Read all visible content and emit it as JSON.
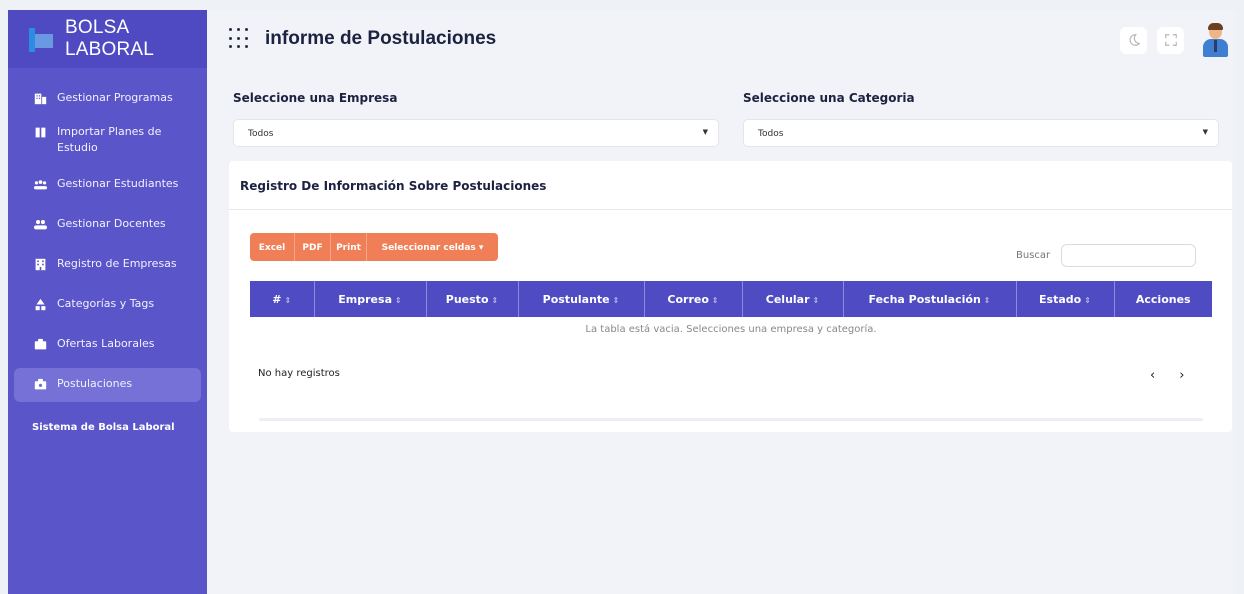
{
  "brand": {
    "title": "BOLSA LABORAL"
  },
  "sidebar": {
    "items": [
      {
        "label": "Gestionar Programas",
        "icon": "building-icon",
        "active": false
      },
      {
        "label": "Importar Planes de Estudio",
        "icon": "book-icon",
        "active": false
      },
      {
        "label": "Gestionar Estudiantes",
        "icon": "users-icon",
        "active": false
      },
      {
        "label": "Gestionar Docentes",
        "icon": "user-group-icon",
        "active": false
      },
      {
        "label": "Registro de Empresas",
        "icon": "building-icon",
        "active": false
      },
      {
        "label": "Categorías y Tags",
        "icon": "shapes-icon",
        "active": false
      },
      {
        "label": "Ofertas Laborales",
        "icon": "briefcase-icon",
        "active": false
      },
      {
        "label": "Postulaciones",
        "icon": "briefcase-user-icon",
        "active": true
      }
    ],
    "system_title": "Sistema de Bolsa Laboral"
  },
  "header": {
    "title": "informe de Postulaciones"
  },
  "filters": {
    "empresa_label": "Seleccione una Empresa",
    "empresa_value": "Todos",
    "categoria_label": "Seleccione una Categoria",
    "categoria_value": "Todos"
  },
  "card": {
    "title": "Registro De Información Sobre Postulaciones",
    "export_buttons": [
      "Excel",
      "PDF",
      "Print",
      "Seleccionar celdas ▾"
    ],
    "search_label": "Buscar",
    "columns": [
      "#",
      "Empresa",
      "Puesto",
      "Postulante",
      "Correo",
      "Celular",
      "Fecha Postulación",
      "Estado",
      "Acciones"
    ],
    "empty_message": "La tabla está vacia. Selecciones una empresa y categoría.",
    "records_text": "No hay registros",
    "prev": "‹",
    "next": "›"
  },
  "colors": {
    "sidebar": "#5a55c9",
    "table_header": "#4e4bc3",
    "export_button": "#f07f57"
  }
}
